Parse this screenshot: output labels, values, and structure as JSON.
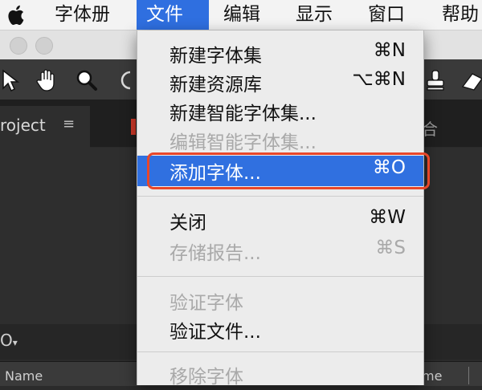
{
  "menubar": {
    "apple": "apple-logo-icon",
    "items": [
      "字体册",
      "文件",
      "编辑",
      "显示",
      "窗口",
      "帮助"
    ],
    "active_index": 1
  },
  "app": {
    "project_tab": "roject",
    "tab_menu_icon": "≡",
    "right_tab_partial": "合",
    "strip_text": "O",
    "columns": [
      "Name",
      "me"
    ]
  },
  "file_menu": {
    "items": [
      {
        "label": "新建字体集",
        "shortcut": "⌘N",
        "state": "enabled"
      },
      {
        "label": "新建资源库",
        "shortcut": "⌥⌘N",
        "state": "enabled"
      },
      {
        "label": "新建智能字体集...",
        "shortcut": "",
        "state": "enabled"
      },
      {
        "label": "编辑智能字体集...",
        "shortcut": "",
        "state": "disabled"
      },
      {
        "label": "添加字体...",
        "shortcut": "⌘O",
        "state": "highlighted"
      },
      {
        "label": "关闭",
        "shortcut": "⌘W",
        "state": "enabled"
      },
      {
        "label": "存储报告...",
        "shortcut": "⌘S",
        "state": "disabled"
      },
      {
        "label": "验证字体",
        "shortcut": "",
        "state": "disabled"
      },
      {
        "label": "验证文件...",
        "shortcut": "",
        "state": "enabled"
      },
      {
        "label": "移除字体",
        "shortcut": "",
        "state": "disabled"
      }
    ]
  },
  "colors": {
    "menu_highlight": "#3070e0",
    "callout_border": "#e8472a",
    "menubar_active": "#2f6fe0"
  }
}
